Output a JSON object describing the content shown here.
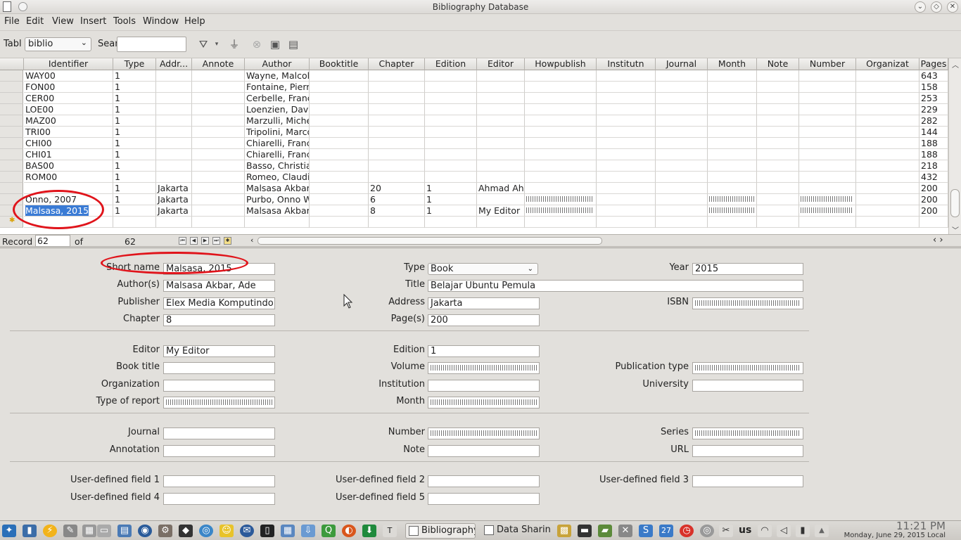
{
  "window": {
    "title": "Bibliography Database"
  },
  "menu": [
    "File",
    "Edit",
    "View",
    "Insert",
    "Tools",
    "Window",
    "Help"
  ],
  "toolbar": {
    "table_label": "Tabl",
    "table_value": "biblio",
    "search_label": "Sear",
    "search_value": ""
  },
  "grid": {
    "columns": [
      "Identifier",
      "Type",
      "Addr...",
      "Annote",
      "Author",
      "Booktitle",
      "Chapter",
      "Edition",
      "Editor",
      "Howpublish",
      "Institutn",
      "Journal",
      "Month",
      "Note",
      "Number",
      "Organizat",
      "Pages"
    ],
    "rows": [
      {
        "id": "WAY00",
        "type": "1",
        "addr": "",
        "author": "Wayne, Malcol",
        "chapter": "",
        "edition": "",
        "editor": "",
        "pages": "643",
        "filled": false
      },
      {
        "id": "FON00",
        "type": "1",
        "addr": "",
        "author": "Fontaine, Pierr",
        "chapter": "",
        "edition": "",
        "editor": "",
        "pages": "158",
        "filled": false
      },
      {
        "id": "CER00",
        "type": "1",
        "addr": "",
        "author": "Cerbelle, Franç",
        "chapter": "",
        "edition": "",
        "editor": "",
        "pages": "253",
        "filled": false
      },
      {
        "id": "LOE00",
        "type": "1",
        "addr": "",
        "author": "Loenzien, Davi",
        "chapter": "",
        "edition": "",
        "editor": "",
        "pages": "229",
        "filled": false
      },
      {
        "id": "MAZ00",
        "type": "1",
        "addr": "",
        "author": "Marzulli, Miche",
        "chapter": "",
        "edition": "",
        "editor": "",
        "pages": "282",
        "filled": false
      },
      {
        "id": "TRI00",
        "type": "1",
        "addr": "",
        "author": "Tripolini, Marco",
        "chapter": "",
        "edition": "",
        "editor": "",
        "pages": "144",
        "filled": false
      },
      {
        "id": "CHI00",
        "type": "1",
        "addr": "",
        "author": "Chiarelli, Franc",
        "chapter": "",
        "edition": "",
        "editor": "",
        "pages": "188",
        "filled": false
      },
      {
        "id": "CHI01",
        "type": "1",
        "addr": "",
        "author": "Chiarelli, Franc",
        "chapter": "",
        "edition": "",
        "editor": "",
        "pages": "188",
        "filled": false
      },
      {
        "id": "BAS00",
        "type": "1",
        "addr": "",
        "author": "Basso, Christia",
        "chapter": "",
        "edition": "",
        "editor": "",
        "pages": "218",
        "filled": false
      },
      {
        "id": "ROM00",
        "type": "1",
        "addr": "",
        "author": "Romeo, Claudi",
        "chapter": "",
        "edition": "",
        "editor": "",
        "pages": "432",
        "filled": false
      },
      {
        "id": "",
        "type": "1",
        "addr": "Jakarta",
        "author": "Malsasa Akbar,",
        "chapter": "20",
        "edition": "1",
        "editor": "Ahmad Ah",
        "pages": "200",
        "filled": false
      },
      {
        "id": "Onno, 2007",
        "type": "1",
        "addr": "Jakarta",
        "author": "Purbo, Onno W",
        "chapter": "6",
        "edition": "1",
        "editor": "",
        "pages": "200",
        "filled": true
      },
      {
        "id": "Malsasa, 2015",
        "type": "1",
        "addr": "Jakarta",
        "author": "Malsasa Akbar,",
        "chapter": "8",
        "edition": "1",
        "editor": "My Editor",
        "pages": "200",
        "filled": true
      }
    ]
  },
  "record": {
    "label": "Record",
    "current": "62",
    "of_label": "of",
    "total": "62"
  },
  "form": {
    "short_name": {
      "label": "Short name",
      "value": "Malsasa, 2015"
    },
    "authors": {
      "label": "Author(s)",
      "value": "Malsasa Akbar, Ade"
    },
    "publisher": {
      "label": "Publisher",
      "value": "Elex Media Komputindo"
    },
    "chapter": {
      "label": "Chapter",
      "value": "8"
    },
    "type": {
      "label": "Type",
      "value": "Book"
    },
    "title": {
      "label": "Title",
      "value": "Belajar Ubuntu Pemula"
    },
    "address": {
      "label": "Address",
      "value": "Jakarta"
    },
    "pages": {
      "label": "Page(s)",
      "value": "200"
    },
    "year": {
      "label": "Year",
      "value": "2015"
    },
    "isbn": {
      "label": "ISBN",
      "value": ""
    },
    "editor": {
      "label": "Editor",
      "value": "My Editor"
    },
    "book_title": {
      "label": "Book title",
      "value": ""
    },
    "organization": {
      "label": "Organization",
      "value": ""
    },
    "type_of_report": {
      "label": "Type of report",
      "value": ""
    },
    "edition": {
      "label": "Edition",
      "value": "1"
    },
    "volume": {
      "label": "Volume",
      "value": ""
    },
    "institution": {
      "label": "Institution",
      "value": ""
    },
    "month": {
      "label": "Month",
      "value": ""
    },
    "publication_type": {
      "label": "Publication type",
      "value": ""
    },
    "university": {
      "label": "University",
      "value": ""
    },
    "journal": {
      "label": "Journal",
      "value": ""
    },
    "annotation": {
      "label": "Annotation",
      "value": ""
    },
    "number": {
      "label": "Number",
      "value": ""
    },
    "note": {
      "label": "Note",
      "value": ""
    },
    "series": {
      "label": "Series",
      "value": ""
    },
    "url": {
      "label": "URL",
      "value": ""
    },
    "udf1": {
      "label": "User-defined field 1",
      "value": ""
    },
    "udf2": {
      "label": "User-defined field 2",
      "value": ""
    },
    "udf3": {
      "label": "User-defined field 3",
      "value": ""
    },
    "udf4": {
      "label": "User-defined field 4",
      "value": ""
    },
    "udf5": {
      "label": "User-defined field 5",
      "value": ""
    }
  },
  "taskbar": {
    "tasks": [
      "Bibliography",
      "Data Sharin"
    ],
    "keyboard": "us",
    "time": "11:21 PM",
    "date": "Monday, June 29, 2015 Local"
  },
  "colors": {
    "annotation_red": "#e0141b",
    "selection": "#3a7bd5"
  }
}
